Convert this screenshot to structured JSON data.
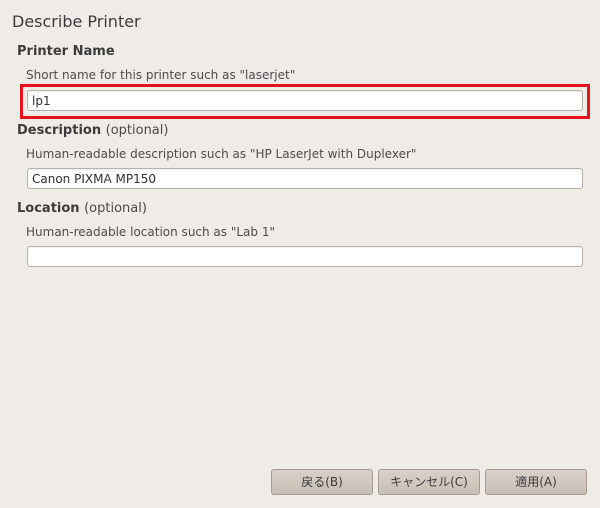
{
  "page": {
    "title": "Describe Printer"
  },
  "printer_name": {
    "heading": "Printer Name",
    "hint": "Short name for this printer such as \"laserjet\"",
    "value": "lp1"
  },
  "description": {
    "heading": "Description",
    "optional": "(optional)",
    "hint": "Human-readable description such as \"HP LaserJet with Duplexer\"",
    "value": "Canon PIXMA MP150"
  },
  "location": {
    "heading": "Location",
    "optional": "(optional)",
    "hint": "Human-readable location such as \"Lab 1\"",
    "value": ""
  },
  "buttons": {
    "back": "戻る(B)",
    "cancel": "キャンセル(C)",
    "apply": "適用(A)"
  },
  "colors": {
    "highlight": "#e8141c",
    "background": "#efebe7"
  }
}
